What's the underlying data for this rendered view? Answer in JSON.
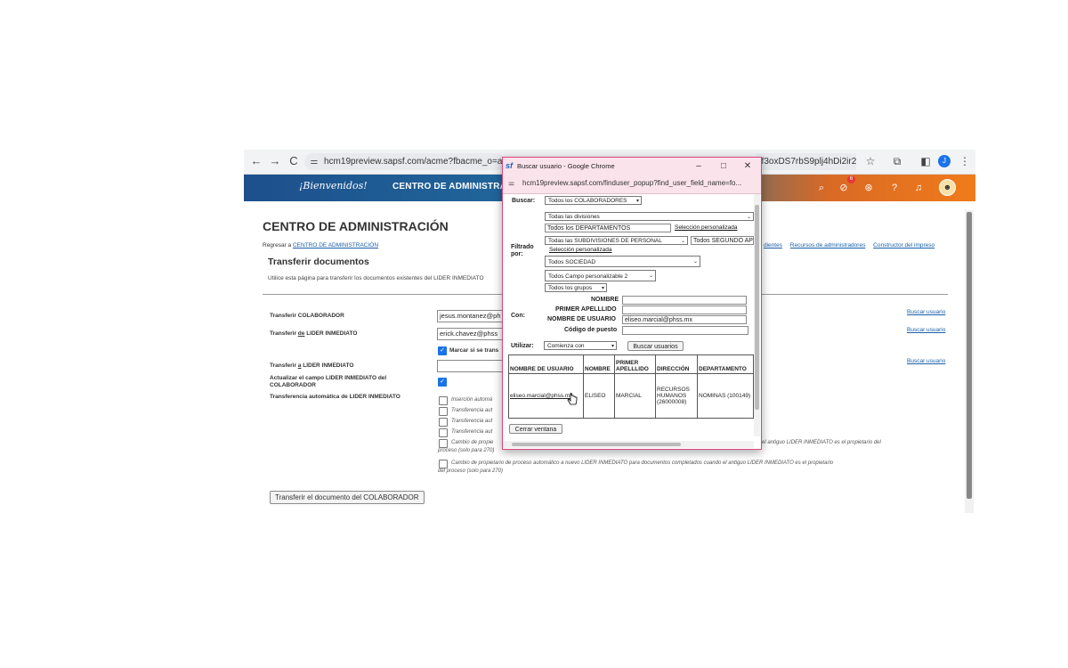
{
  "browser": {
    "url": "hcm19preview.sapsf.com/acme?fbacme_o=admin&p",
    "url_right": "2f3oxDS7rbS9plj4hDi2ir2Nt...",
    "nav": {
      "back": "←",
      "forward": "→",
      "reload": "C"
    },
    "profile_initial": "J"
  },
  "header": {
    "logo": "¡Bienvenidos!",
    "title": "CENTRO DE ADMINISTRAC",
    "badge_count": "6"
  },
  "page": {
    "title": "CENTRO DE ADMINISTRACIÓN",
    "back_prefix": "Regresar a ",
    "back_link": "CENTRO DE ADMINISTRACIÓN",
    "subtitle": "Transferir documentos",
    "intro": "Utilice esta página para transferir los documentos existentes del LIDER INMEDIATO",
    "top_links": [
      "dientes",
      "Recursos de administradores",
      "Constructor del impreso"
    ]
  },
  "form": {
    "transfer_colaborador_label": "Transferir COLABORADOR",
    "transfer_colaborador_value": "jesus.montanez@ph",
    "transfer_de_label_1": "Transferir ",
    "transfer_de_label_de": "de",
    "transfer_de_label_2": " LIDER INMEDIATO",
    "transfer_de_value": "erick.chavez@phss",
    "marcar_label": "Marcar si se trans",
    "transfer_a_label_1": "Transferir ",
    "transfer_a_label_a": "a",
    "transfer_a_label_2": " LIDER INMEDIATO",
    "transfer_a_value": "",
    "actualizar_label": "Actualizar el campo LIDER INMEDIATO del COLABORADOR",
    "auto_label": "Transferencia automática de LIDER INMEDIATO",
    "options": [
      "Inserción automá",
      "Transferencia aut",
      "Transferencia aut",
      "Transferencia aut"
    ],
    "cambio_1_a": "Cambio de propie",
    "cambio_1_b": "el antiguo LIDER INMEDIATO es el propietario del",
    "cambio_1_c": "proceso (solo para 270)",
    "cambio_2_a": "Cambio de propietario de proceso automático a nuevo LIDER INMEDIATO para documentos completados cuando el antiguo LIDER INMEDIATO es el propietario",
    "cambio_2_b": "del proceso (solo para 270)",
    "buscar_usuario": "Buscar usuario",
    "submit": "Transferir el documento del COLABORADOR"
  },
  "popup": {
    "logo": "sf",
    "window_title": "Buscar usuario - Google Chrome",
    "url": "hcm19preview.sapsf.com/finduser_popup?find_user_field_name=fo...",
    "buscar_label": "Buscar:",
    "buscar_value": "Todos los COLABORADORES",
    "filtrado_label": "Filtrado por:",
    "divisiones": "Todas las divisiones",
    "departamentos": "Todos los DEPARTAMENTOS",
    "seleccion_personalizada": "Selección personalizada",
    "subdivisiones": "Todas las SUBDIVISIONES DE PERSONAL",
    "segundo": "Todos SEGUNDO AP",
    "sociedad": "Todos SOCIEDAD",
    "campo_personalizable": "Todos Campo personalizable 2",
    "grupos": "Todos los grupos",
    "con_label": "Con:",
    "nombre_label": "NOMBRE",
    "nombre_value": "",
    "apellido_label": "PRIMER APELLLIDO",
    "apellido_value": "",
    "usuario_label": "NOMBRE DE USUARIO",
    "usuario_value": "eliseo.marcial@phss.mx",
    "codigo_label": "Código de puesto",
    "codigo_value": "",
    "utilizar_label": "Utilizar:",
    "utilizar_value": "Comienza con",
    "buscar_btn": "Buscar usuarios",
    "columns": [
      "NOMBRE DE USUARIO",
      "NOMBRE",
      "PRIMER APELLLIDO",
      "DIRECCIÓN",
      "DEPARTAMENTO"
    ],
    "row": {
      "usuario": "eliseo.marcial@phss.mx",
      "nombre": "ELISEO",
      "apellido": "MARCIAL",
      "direccion": "RECURSOS HUMANOS (26000008)",
      "departamento": "NOMINAS (100149)"
    },
    "cerrar": "Cerrar ventana"
  },
  "colors": {
    "link": "#1a5fa8",
    "checkbox": "#1a73e8",
    "popup_frame": "#fbe3ec",
    "header_blue": "#1d4f8c",
    "header_orange": "#f07b1a"
  },
  "icons": [
    "back-icon",
    "forward-icon",
    "reload-icon",
    "tune-icon",
    "star-icon",
    "extensions-icon",
    "sidepanel-icon",
    "menu-icon",
    "search-icon",
    "todo-icon",
    "help-icon",
    "notification-icon",
    "minimize-icon",
    "maximize-icon",
    "close-icon",
    "cursor-hand-icon"
  ]
}
